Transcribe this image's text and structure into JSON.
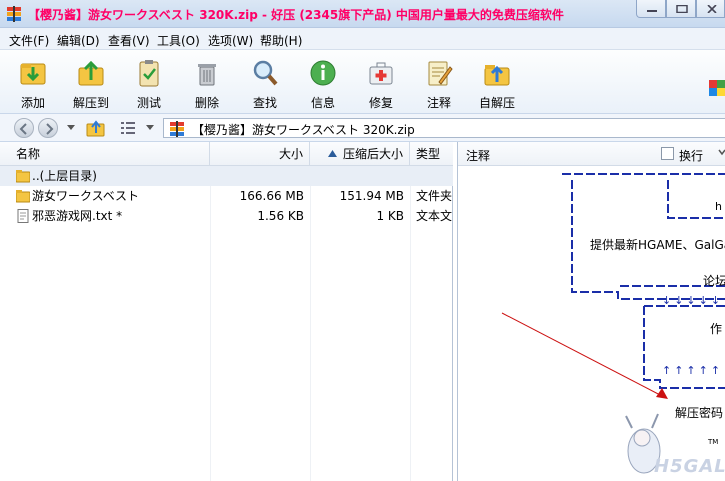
{
  "window": {
    "title": "【樱乃酱】游女ワークスベスト 320K.zip - 好压 (2345旗下产品) 中国用户量最大的免费压缩软件"
  },
  "menu": [
    "文件(F)",
    "编辑(D)",
    "查看(V)",
    "工具(O)",
    "选项(W)",
    "帮助(H)"
  ],
  "toolbar": {
    "add": "添加",
    "extract": "解压到",
    "test": "测试",
    "delete": "删除",
    "find": "查找",
    "info": "信息",
    "repair": "修复",
    "comment": "注释",
    "sfx": "自解压"
  },
  "address": {
    "path": "【樱乃酱】游女ワークスベスト 320K.zip"
  },
  "columns": {
    "name": "名称",
    "size": "大小",
    "packed": "压缩后大小",
    "type": "类型"
  },
  "files": [
    {
      "name": "..(上层目录)",
      "size": "",
      "packed": "",
      "type": ""
    },
    {
      "name": "游女ワークスベスト",
      "size": "166.66 MB",
      "packed": "151.94 MB",
      "type": "文件夹"
    },
    {
      "name": "邪恶游戏网.txt *",
      "size": "1.56 KB",
      "packed": "1 KB",
      "type": "文本文"
    }
  ],
  "comment_pane": {
    "title": "注释",
    "wrap": "换行",
    "lines": {
      "h": "h",
      "site": "提供最新HGAME、GalGame",
      "forum": "论坛",
      "arrows_down": "↓↓↓↓↓↓",
      "zuo": "作",
      "arrows_up": "↑↑↑↑↑↑",
      "password": "解压密码",
      "logo": "H5GAL",
      "tm": "TM"
    }
  },
  "colors": {
    "title_text": "#ff0066",
    "dashed_frame": "#1a2ea8",
    "arrow_line": "#cc1111"
  }
}
